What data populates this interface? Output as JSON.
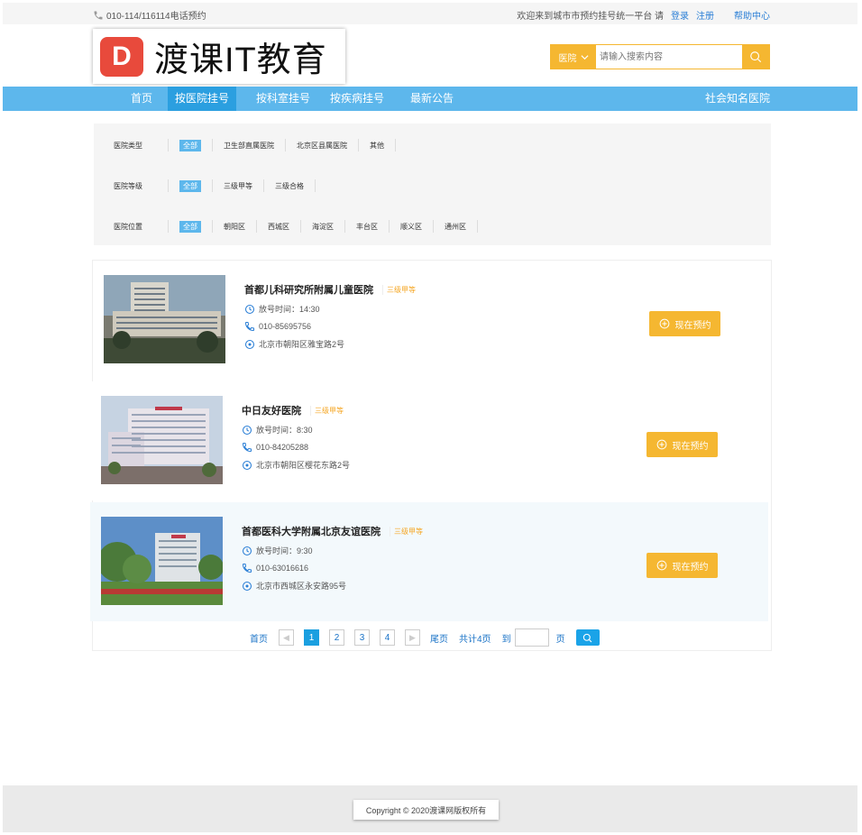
{
  "topbar": {
    "phone": "010-114/116114电话预约",
    "welcome": "欢迎来到城市市预约挂号统一平台 请",
    "login": "登录",
    "register": "注册",
    "help": "帮助中心"
  },
  "logo": {
    "mark": "D",
    "text": "渡课IT教育"
  },
  "search": {
    "type": "医院",
    "placeholder": "请输入搜索内容"
  },
  "nav": {
    "items": [
      "首页",
      "按医院挂号",
      "按科室挂号",
      "按疾病挂号",
      "最新公告"
    ],
    "right": "社会知名医院",
    "active_index": 1
  },
  "filters": [
    {
      "label": "医院类型",
      "options": [
        "全部",
        "卫生部直属医院",
        "北京区县属医院",
        "其他"
      ]
    },
    {
      "label": "医院等级",
      "options": [
        "全部",
        "三级甲等",
        "三级合格"
      ]
    },
    {
      "label": "医院位置",
      "options": [
        "全部",
        "朝阳区",
        "西城区",
        "海淀区",
        "丰台区",
        "顺义区",
        "通州区"
      ]
    }
  ],
  "hospitals": [
    {
      "name": "首都儿科研究所附属儿童医院",
      "level": "三级甲等",
      "time": "放号时间：14:30",
      "phone": "010-85695756",
      "address": "北京市朝阳区雅宝路2号",
      "action": "现在预约"
    },
    {
      "name": "中日友好医院",
      "level": "三级甲等",
      "time": "放号时间：8:30",
      "phone": "010-84205288",
      "address": "北京市朝阳区樱花东路2号",
      "action": "现在预约"
    },
    {
      "name": "首都医科大学附属北京友谊医院",
      "level": "三级甲等",
      "time": "放号时间：9:30",
      "phone": "010-63016616",
      "address": "北京市西城区永安路95号",
      "action": "现在预约"
    }
  ],
  "pager": {
    "first": "首页",
    "pages": [
      "1",
      "2",
      "3",
      "4"
    ],
    "current": "1",
    "last": "尾页",
    "total": "共计4页",
    "goto": "到",
    "page_unit": "页"
  },
  "footer": {
    "copyright": "Copyright © 2020渡课网版权所有"
  },
  "colors": {
    "nav": "#5db7ec",
    "accent": "#f5b731",
    "link": "#1a73c7"
  }
}
